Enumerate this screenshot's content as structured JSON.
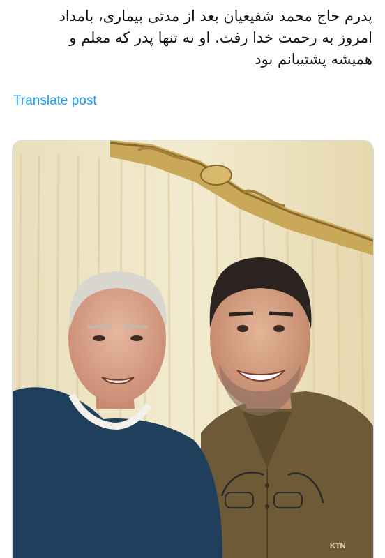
{
  "post": {
    "text_lines": [
      "پدرم حاج محمد شفیعیان بعد از مدتی بیماری، بامداد",
      "امروز به رحمت خدا رفت. او نه تنها پدر که معلم و",
      "همیشه پشتیبانم بود"
    ],
    "translate_label": "Translate post"
  },
  "media": {
    "alt": "Selfie of an elderly man and a younger smiling man in front of a cream curtain",
    "shirt_logo_text": "KTN"
  },
  "colors": {
    "link": "#1d9bf0",
    "text": "#0f1419",
    "curtain": "#efe6c6",
    "gold_valance": "#c9a85a",
    "navy_sweater": "#1f3f5c",
    "olive_shirt": "#6e5a36"
  }
}
